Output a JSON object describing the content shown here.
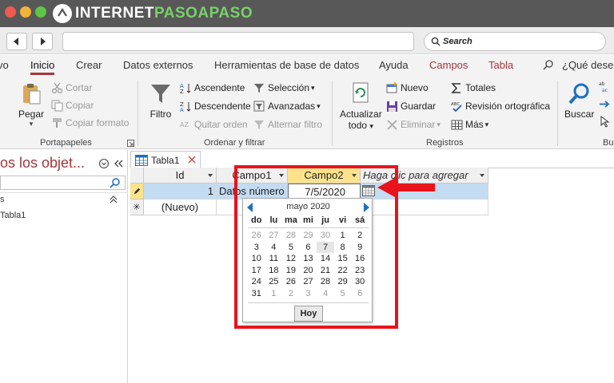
{
  "brand": {
    "logo_prefix": "INTERNET",
    "logo_suffix": "PASOAPASO"
  },
  "browser": {
    "search_placeholder": "Search"
  },
  "ribbon_tabs": [
    "vo",
    "Inicio",
    "Crear",
    "Datos externos",
    "Herramientas de base de datos",
    "Ayuda",
    "Campos",
    "Tabla",
    "¿Qué desea"
  ],
  "ribbon": {
    "portapapeles": {
      "pegar": "Pegar",
      "cortar": "Cortar",
      "copiar": "Copiar",
      "copiar_formato": "Copiar formato",
      "label": "Portapapeles"
    },
    "ordenar": {
      "filtro": "Filtro",
      "ascendente": "Ascendente",
      "descendente": "Descendente",
      "quitar_orden": "Quitar orden",
      "seleccion": "Selección",
      "avanzadas": "Avanzadas",
      "alternar_filtro": "Alternar filtro",
      "label": "Ordenar y filtrar"
    },
    "registros": {
      "actualizar": "Actualizar",
      "todo": "todo",
      "nuevo": "Nuevo",
      "guardar": "Guardar",
      "eliminar": "Eliminar",
      "totales": "Totales",
      "revision": "Revisión ortográfica",
      "mas": "Más",
      "label": "Registros"
    },
    "buscar": {
      "buscar": "Buscar",
      "label": "Bu"
    }
  },
  "navpane": {
    "title": "os los objet...",
    "group": "s",
    "item": "Tabla1"
  },
  "document_tab": {
    "label": "Tabla1"
  },
  "datasheet": {
    "headers": [
      "Id",
      "Campo1",
      "Campo2",
      "Haga clic para agregar"
    ],
    "row1": {
      "id": "1",
      "campo1": "Datos número",
      "campo2": "7/5/2020"
    },
    "new_row": {
      "label": "(Nuevo)"
    }
  },
  "calendar": {
    "month_label": "mayo 2020",
    "weekdays": [
      "do",
      "lu",
      "ma",
      "mi",
      "ju",
      "vi",
      "sá"
    ],
    "weeks": [
      [
        "26",
        "27",
        "28",
        "29",
        "30",
        "1",
        "2"
      ],
      [
        "3",
        "4",
        "5",
        "6",
        "7",
        "8",
        "9"
      ],
      [
        "10",
        "11",
        "12",
        "13",
        "14",
        "15",
        "16"
      ],
      [
        "17",
        "18",
        "19",
        "20",
        "21",
        "22",
        "23"
      ],
      [
        "24",
        "25",
        "26",
        "27",
        "28",
        "29",
        "30"
      ],
      [
        "31",
        "1",
        "2",
        "3",
        "4",
        "5",
        "6"
      ]
    ],
    "today_label": "Hoy"
  },
  "colors": {
    "accent": "#a4373a",
    "highlight": "#fbe38c",
    "annotation": "#e8141c",
    "selection": "#c4dcf2"
  }
}
